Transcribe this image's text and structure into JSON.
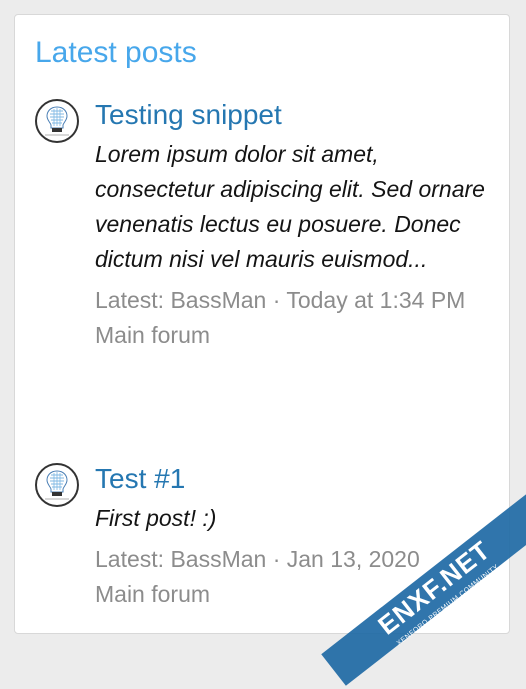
{
  "widget": {
    "title": "Latest posts"
  },
  "posts": [
    {
      "title": "Testing snippet",
      "snippet": "Lorem ipsum dolor sit amet, consectetur adipiscing elit. Sed ornare venenatis lectus eu posuere. Donec dictum nisi vel mauris euismod...",
      "latest_prefix": "Latest: ",
      "user": "BassMan",
      "separator": " · ",
      "time": "Today at 1:34 PM",
      "forum": "Main forum",
      "avatar_icon": "lightbulb-icon"
    },
    {
      "title": "Test #1",
      "snippet": "First post! :)",
      "latest_prefix": "Latest: ",
      "user": "BassMan",
      "separator": " · ",
      "time": "Jan 13, 2020",
      "forum": "Main forum",
      "avatar_icon": "lightbulb-icon"
    }
  ],
  "watermark": {
    "text": "ENXF.NET",
    "subtext": "XENFORO PREMIUM COMMUNITY"
  },
  "colors": {
    "title": "#47a7eb",
    "link": "#2577b1",
    "meta": "#8c8c8c",
    "watermark": "#1f6aa5"
  }
}
